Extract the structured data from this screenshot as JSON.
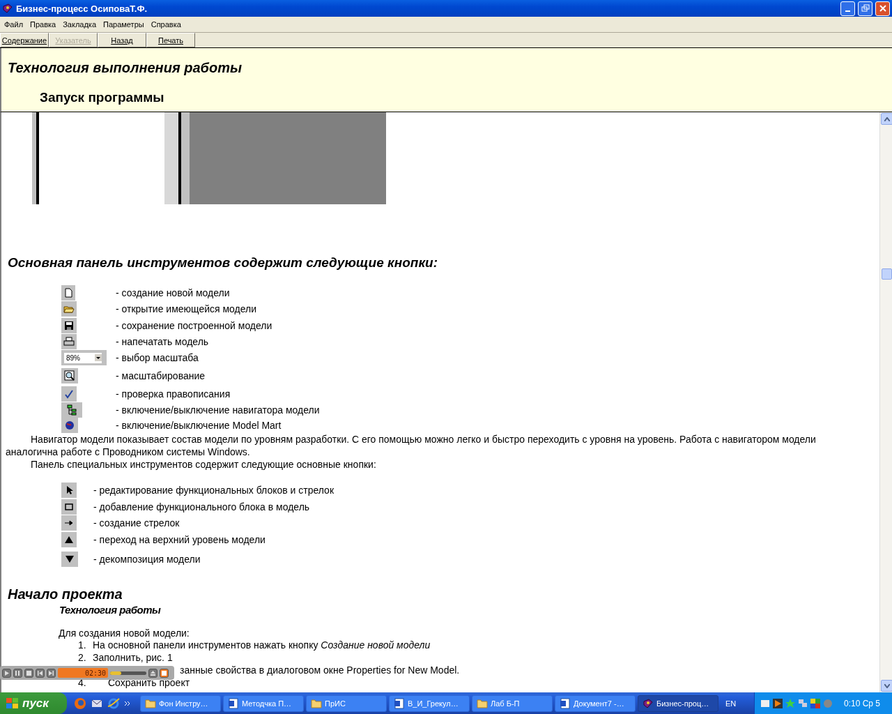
{
  "window": {
    "title": "Бизнес-процесс ОсиповаТ.Ф."
  },
  "menu": [
    "Файл",
    "Правка",
    "Закладка",
    "Параметры",
    "Справка"
  ],
  "toolbar": [
    {
      "label": "Содержание",
      "disabled": false
    },
    {
      "label": "Указатель",
      "disabled": true
    },
    {
      "label": "Назад",
      "disabled": false
    },
    {
      "label": "Печать",
      "disabled": false
    }
  ],
  "header": {
    "title": "Технология выполнения работы",
    "subtitle": "Запуск программы"
  },
  "content": {
    "tools_heading": "Основная панель инструментов содержит следующие кнопки:",
    "main_tools": [
      {
        "kind": "new",
        "text": "- создание новой модели"
      },
      {
        "kind": "open",
        "text": "- открытие имеющейся модели"
      },
      {
        "kind": "save",
        "text": "- сохранение построенной модели"
      },
      {
        "kind": "print",
        "text": "- напечатать модель"
      },
      {
        "kind": "combo",
        "value": "89%",
        "text": "- выбор масштаба"
      },
      {
        "kind": "zoom",
        "text": "- масштабирование"
      },
      {
        "kind": "spell",
        "text": "- проверка правописания"
      },
      {
        "kind": "navigator",
        "text": "- включение/выключение навигатора модели"
      },
      {
        "kind": "mart",
        "text": "- включение/выключение Model Mart"
      }
    ],
    "paragraphs": [
      "Навигатор модели показывает состав модели по уровням разработки. С его помощью можно легко и быстро переходить с уровня на уровень. Работа с навигатором модели аналогична работе с Проводником системы Windows.",
      "Панель специальных инструментов содержит следующие основные кнопки:"
    ],
    "special_tools": [
      {
        "kind": "pointer",
        "text": "- редактирование функциональных блоков и стрелок"
      },
      {
        "kind": "box",
        "text": "- добавление функционального блока в модель"
      },
      {
        "kind": "arrow",
        "text": "- создание стрелок"
      },
      {
        "kind": "up",
        "text": "- переход на верхний уровень модели"
      },
      {
        "kind": "down",
        "text": "- декомпозиция модели"
      }
    ],
    "project_heading": "Начало проекта",
    "project_subheading": "Технология работы",
    "intro": "Для создания новой модели:",
    "steps": [
      {
        "number": "1.",
        "text": "На основной панели инструментов нажать кнопку *Создание новой модели*"
      },
      {
        "number": "2.",
        "text": "Заполнить, рис. 1"
      },
      {
        "text": "занные свойства в диалоговом окне Properties for New Model."
      },
      {
        "number": "4.",
        "text": "Сохранить проект"
      }
    ]
  },
  "player": {
    "time": "02:30",
    "level": 0.3
  },
  "taskbar": {
    "start": "пуск",
    "tasks": [
      {
        "kind": "folder",
        "label": "Фон Инстру…",
        "selected": false
      },
      {
        "kind": "document",
        "label": "Методчка П…",
        "selected": false
      },
      {
        "kind": "folder",
        "label": "ПрИС",
        "selected": false
      },
      {
        "kind": "document",
        "label": "В_И_Грекул…",
        "selected": false
      },
      {
        "kind": "folder",
        "label": "Лаб Б-П",
        "selected": false
      },
      {
        "kind": "document",
        "label": "Документ7 -…",
        "selected": false
      },
      {
        "kind": "book",
        "label": "Бизнес-проц…",
        "selected": true
      }
    ],
    "language": "EN",
    "clock": "0:10 Ср 5"
  }
}
